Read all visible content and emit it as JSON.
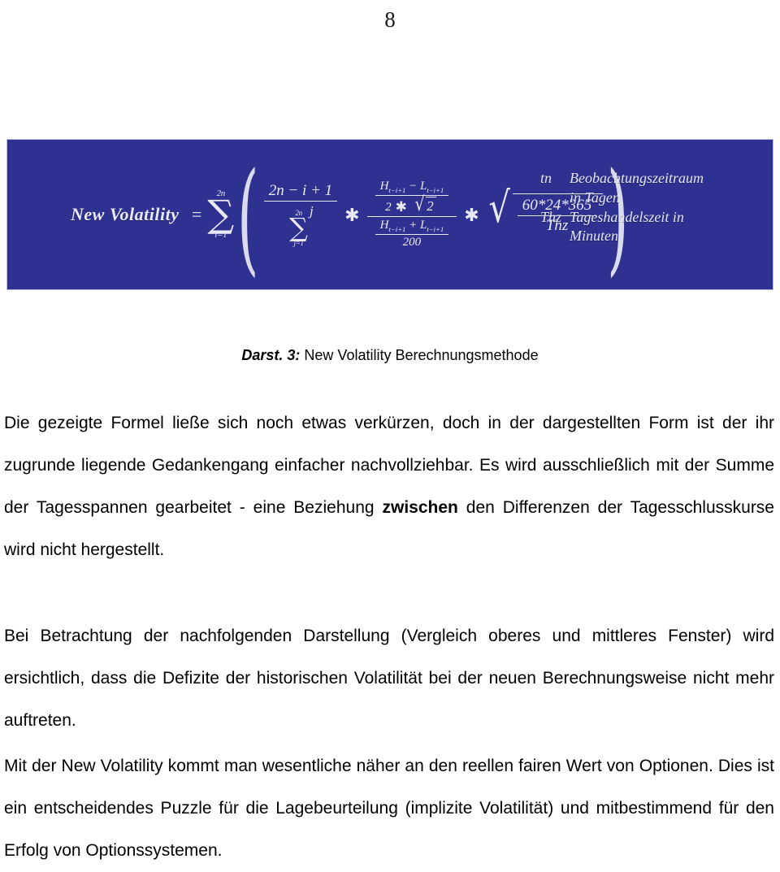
{
  "page": {
    "number": "8"
  },
  "figure": {
    "background_color": "#2e3190",
    "border_color": "#b9bcd8",
    "text_color": "#e9eaf5",
    "formula": {
      "lhs": "New Volatility",
      "equals": "=",
      "outer_sum": {
        "upper": "2n",
        "lower": "i=1",
        "symbol": "∑"
      },
      "inner_sum": {
        "upper": "2n",
        "lower": "j=1",
        "symbol": "∑",
        "body": "j"
      },
      "weight_numerator": "2n − i + 1",
      "range_numerator_h": "H",
      "range_numerator_h_sub": "t−i+1",
      "range_minus": "−",
      "range_numerator_l": "L",
      "range_numerator_l_sub": "t−i+1",
      "range_denominator_prefix": "2",
      "range_denominator_sqrt": "2",
      "mid_numerator_h": "H",
      "mid_numerator_h_sub": "t−i+1",
      "mid_plus": "+",
      "mid_numerator_l": "L",
      "mid_numerator_l_sub": "t−i+1",
      "mid_denominator": "200",
      "annual_numerator": "60*24*365",
      "annual_denominator": "Thz",
      "multiply": "✱",
      "open_paren": "(",
      "close_paren": ")"
    },
    "legend": [
      {
        "key": "tn",
        "value": "Beobachtungszeitraum",
        "cont": "in Tagen"
      },
      {
        "key": "Thz",
        "value": "Tageshandelszeit in",
        "cont": "Minuten"
      }
    ]
  },
  "caption": {
    "label": "Darst. 3:",
    "text": " New Volatility Berechnungsmethode"
  },
  "paragraphs": {
    "p1_a": "Die gezeigte Formel ließe sich noch etwas verkürzen, doch in der dargestellten Form ist der ihr zugrunde liegende Gedankengang einfacher nachvollziehbar. Es wird ausschließlich mit der Summe der Tagesspannen gearbeitet - eine Beziehung ",
    "p1_bold": "zwischen",
    "p1_b": " den Differenzen der Tagesschlusskurse wird nicht hergestellt.",
    "p2": "Bei Betrachtung der nachfolgenden Darstellung  (Vergleich oberes und mittleres Fenster) wird ersichtlich, dass die Defizite der historischen Volatilität bei der neuen Berechnungsweise nicht mehr auftreten.",
    "p3": "Mit der New Volatility kommt man wesentliche näher an den reellen fairen Wert von Optionen. Dies ist ein entscheidendes Puzzle für die Lagebeurteilung (implizite Volatilität) und mitbestimmend für den Erfolg von Optionssystemen."
  }
}
